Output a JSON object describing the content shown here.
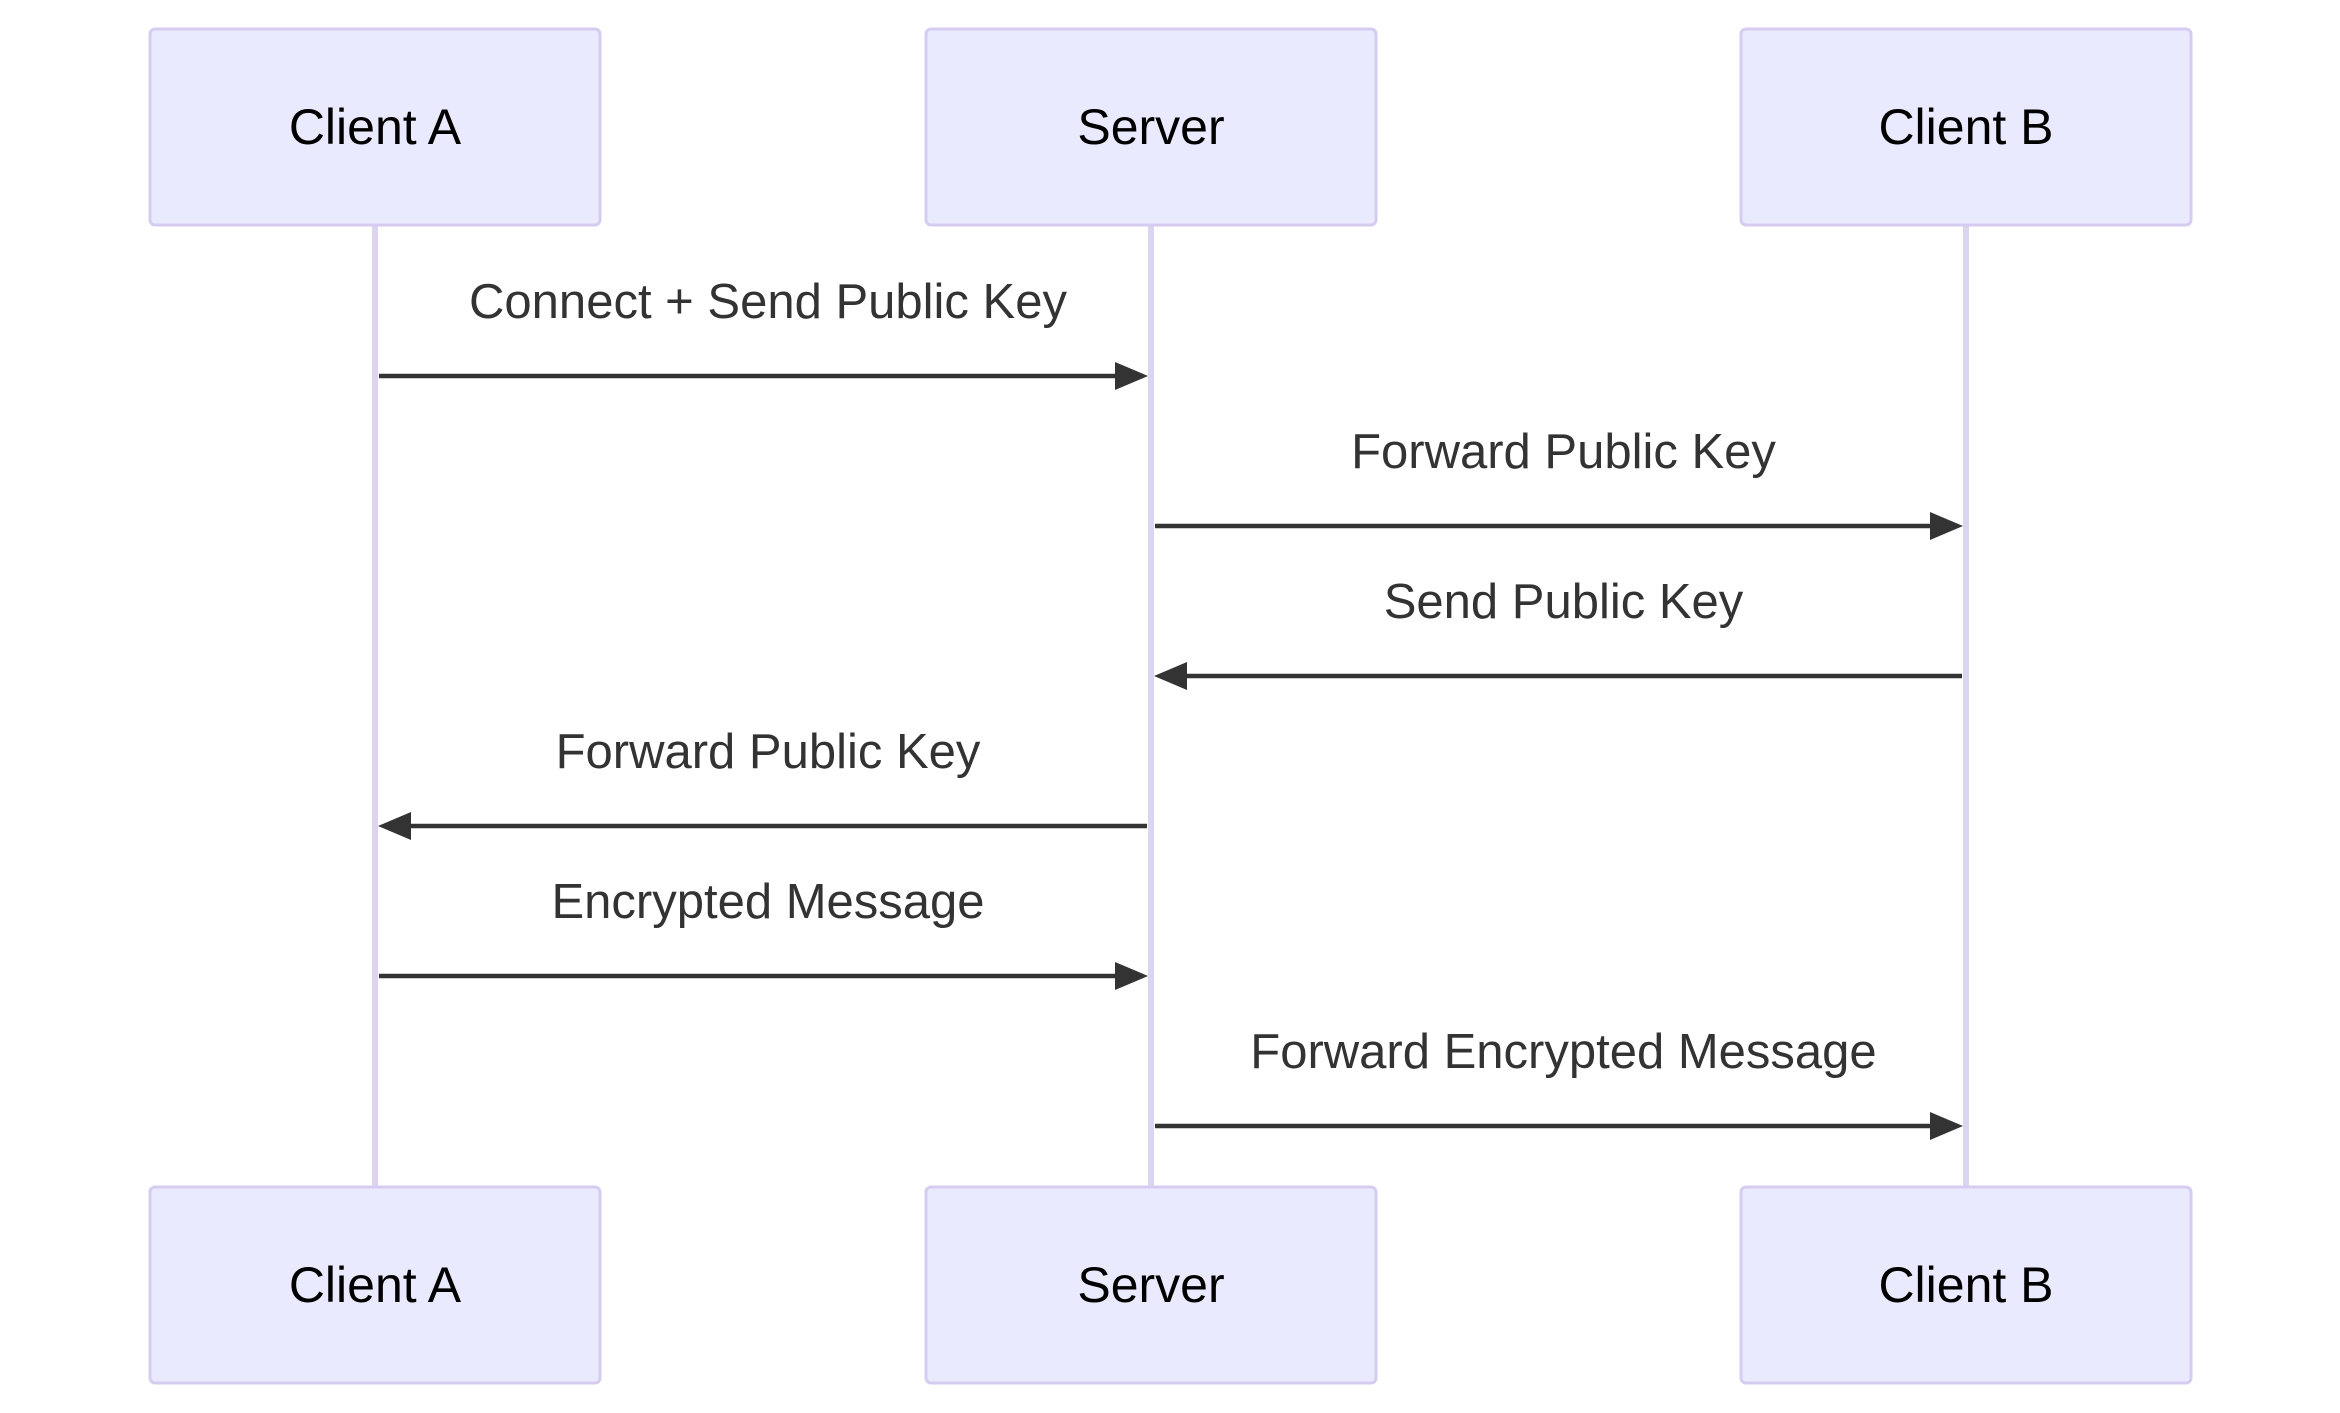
{
  "diagram": {
    "type": "sequence",
    "participants": [
      {
        "id": "A",
        "label": "Client A"
      },
      {
        "id": "S",
        "label": "Server"
      },
      {
        "id": "B",
        "label": "Client B"
      }
    ],
    "messages": [
      {
        "from": "A",
        "to": "S",
        "label": "Connect + Send Public Key"
      },
      {
        "from": "S",
        "to": "B",
        "label": "Forward Public Key"
      },
      {
        "from": "B",
        "to": "S",
        "label": "Send Public Key"
      },
      {
        "from": "S",
        "to": "A",
        "label": "Forward Public Key"
      },
      {
        "from": "A",
        "to": "S",
        "label": "Encrypted Message"
      },
      {
        "from": "S",
        "to": "B",
        "label": "Forward Encrypted Message"
      }
    ],
    "colors": {
      "actor_fill": "#eaeaff",
      "actor_stroke": "#d5ccf0",
      "lifeline": "#ddd4f2",
      "arrow": "#333333",
      "label": "#333333",
      "actor_text": "#000000"
    }
  }
}
